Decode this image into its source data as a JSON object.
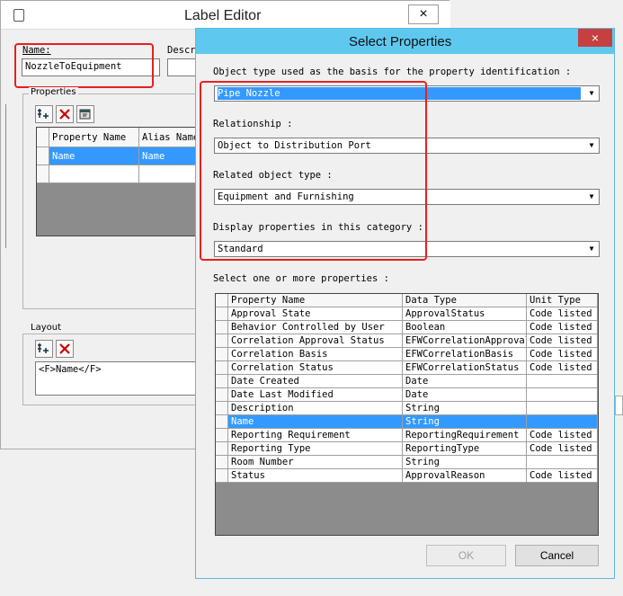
{
  "label_editor": {
    "title": "Label Editor",
    "close_symbol": "×",
    "name_label": "Name:",
    "name_value": "NozzleToEquipment",
    "description_label": "Descri",
    "properties_group": "Properties",
    "properties_columns": [
      "Property Name",
      "Alias Name"
    ],
    "properties_rows": [
      [
        "Name",
        "Name"
      ]
    ],
    "layout_group": "Layout",
    "layout_value": "<F>Name</F>"
  },
  "select_properties": {
    "title": "Select Properties",
    "close_symbol": "×",
    "object_type_label": "Object type used as the basis for the property identification :",
    "object_type_value": "Pipe Nozzle",
    "relationship_label": "Relationship :",
    "relationship_value": "Object to Distribution Port",
    "related_object_label": "Related object type :",
    "related_object_value": "Equipment and Furnishing",
    "category_label": "Display properties in this category :",
    "category_value": "Standard",
    "select_label": "Select one or more properties :",
    "columns": [
      "Property Name",
      "Data Type",
      "Unit Type"
    ],
    "rows": [
      [
        "Approval State",
        "ApprovalStatus",
        "Code listed"
      ],
      [
        "Behavior Controlled by User",
        "Boolean",
        "Code listed"
      ],
      [
        "Correlation Approval Status",
        "EFWCorrelationApproval",
        "Code listed"
      ],
      [
        "Correlation Basis",
        "EFWCorrelationBasis",
        "Code listed"
      ],
      [
        "Correlation Status",
        "EFWCorrelationStatus",
        "Code listed"
      ],
      [
        "Date Created",
        "Date",
        ""
      ],
      [
        "Date Last Modified",
        "Date",
        ""
      ],
      [
        "Description",
        "String",
        ""
      ],
      [
        "Name",
        "String",
        ""
      ],
      [
        "Reporting Requirement",
        "ReportingRequirement",
        "Code listed"
      ],
      [
        "Reporting Type",
        "ReportingType",
        "Code listed"
      ],
      [
        "Room Number",
        "String",
        ""
      ],
      [
        "Status",
        "ApprovalReason",
        "Code listed"
      ]
    ],
    "selected_row": "Name",
    "ok_label": "OK",
    "cancel_label": "Cancel"
  }
}
